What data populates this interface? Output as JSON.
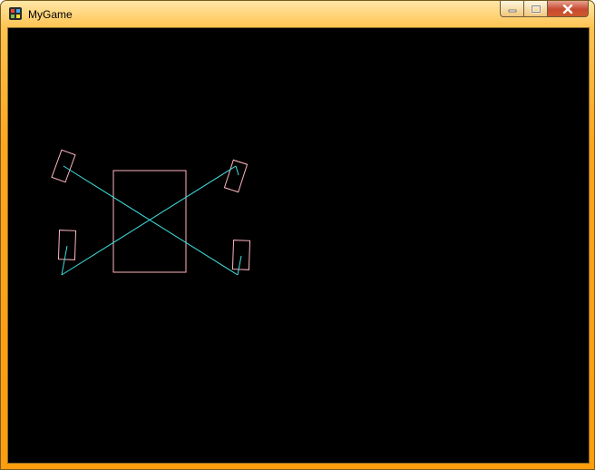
{
  "window": {
    "title": "MyGame",
    "app_icon": "game-controller-icon",
    "buttons": {
      "minimize_icon": "minimize-icon",
      "maximize_icon": "maximize-icon",
      "close_icon": "close-icon"
    }
  },
  "scene": {
    "background_color": "#000000",
    "body_outline_color": "#ffb6c1",
    "wheel_outline_color": "#ffb6c1",
    "axle_line_color": "#40e0e0"
  }
}
